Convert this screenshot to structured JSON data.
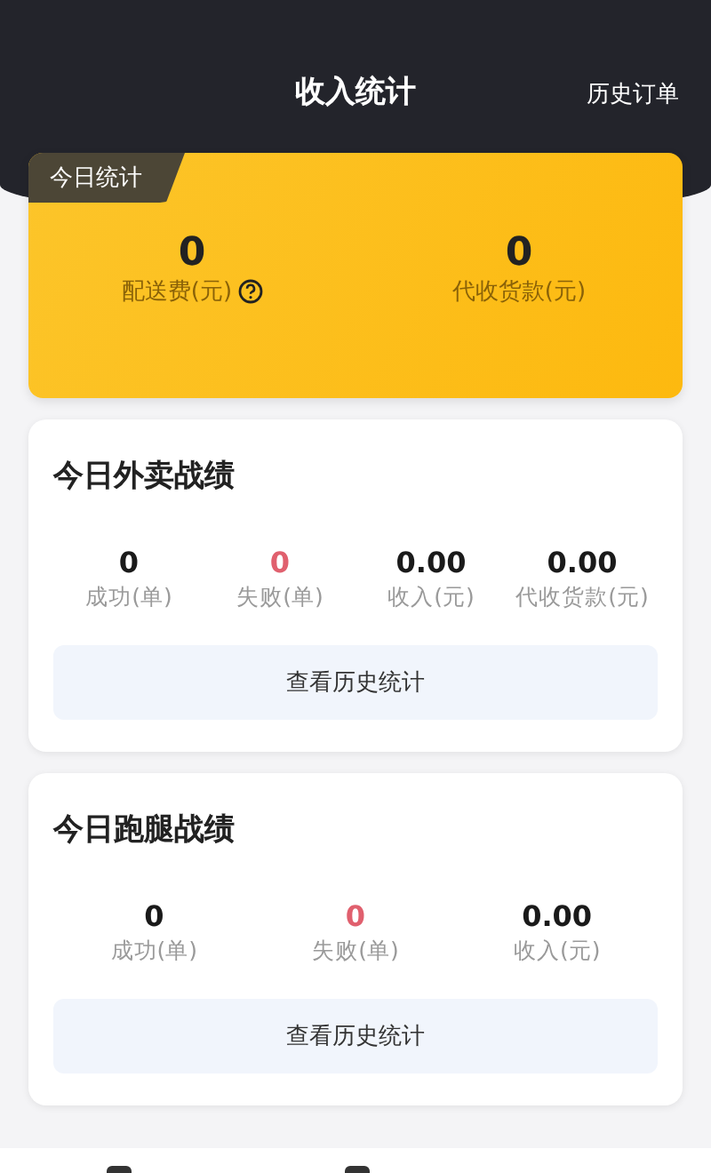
{
  "header": {
    "title": "收入统计",
    "action": "历史订单"
  },
  "today": {
    "tag": "今日统计",
    "stats": [
      {
        "value": "0",
        "label": "配送费(元)",
        "help": true
      },
      {
        "value": "0",
        "label": "代收货款(元)",
        "help": false
      }
    ]
  },
  "sections": [
    {
      "title": "今日外卖战绩",
      "stats": [
        {
          "value": "0",
          "label": "成功(单)",
          "kind": "success"
        },
        {
          "value": "0",
          "label": "失败(单)",
          "kind": "failed"
        },
        {
          "value": "0.00",
          "label": "收入(元)",
          "kind": "amount"
        },
        {
          "value": "0.00",
          "label": "代收货款(元)",
          "kind": "amount"
        }
      ],
      "button": "查看历史统计"
    },
    {
      "title": "今日跑腿战绩",
      "stats": [
        {
          "value": "0",
          "label": "成功(单)",
          "kind": "success"
        },
        {
          "value": "0",
          "label": "失败(单)",
          "kind": "failed"
        },
        {
          "value": "0.00",
          "label": "收入(元)",
          "kind": "amount"
        }
      ],
      "button": "查看历史统计"
    }
  ]
}
